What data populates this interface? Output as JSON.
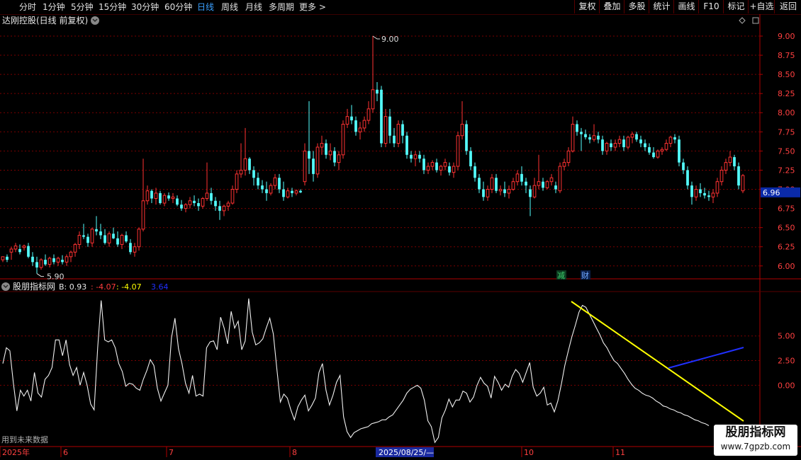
{
  "toolbar": {
    "periods": [
      {
        "label": "分时",
        "active": false
      },
      {
        "label": "1分钟",
        "active": false
      },
      {
        "label": "5分钟",
        "active": false
      },
      {
        "label": "15分钟",
        "active": false
      },
      {
        "label": "30分钟",
        "active": false
      },
      {
        "label": "60分钟",
        "active": false
      },
      {
        "label": "日线",
        "active": true
      },
      {
        "label": "周线",
        "active": false
      },
      {
        "label": "月线",
        "active": false
      },
      {
        "label": "多周期",
        "active": false
      },
      {
        "label": "更多 >",
        "active": false
      }
    ],
    "right_buttons": [
      "复权",
      "叠加",
      "多股",
      "统计",
      "画线",
      "F10",
      "标记",
      "+自选",
      "返回"
    ]
  },
  "main_chart": {
    "title": "达刚控股(日线 前复权)",
    "high_label": "9.00",
    "low_label": "5.90",
    "current_price": "6.96",
    "y_ticks": [
      "9.00",
      "8.75",
      "8.50",
      "8.25",
      "8.00",
      "7.75",
      "7.50",
      "7.25",
      "7.00",
      "6.75",
      "6.50",
      "6.25",
      "6.00"
    ],
    "event_markers": [
      {
        "label": "减"
      },
      {
        "label": "财"
      }
    ],
    "colors": {
      "up": "#ff3232",
      "down": "#54ffff",
      "grid": "#7a0000"
    }
  },
  "indicator": {
    "name": "股朋指标网",
    "b_label": "B: 0.93",
    "v2": "-4.07",
    "v3": ": -4.07",
    "v4": "3.64",
    "y_ticks": [
      "5.00",
      "2.50",
      "0.00"
    ],
    "footer_note": "用到未来数据"
  },
  "time_axis": {
    "labels": [
      "2025年",
      "6",
      "7",
      "8",
      "2025/08/25/—",
      "10",
      "11"
    ]
  },
  "watermark": {
    "line1": "股朋指标网",
    "line2": "www.7gpzb.com"
  },
  "chart_data": {
    "type": "candlestick",
    "price_range": [
      5.85,
      9.12
    ],
    "candles": [
      [
        6.08,
        6.12,
        6.05,
        6.12
      ],
      [
        6.12,
        6.15,
        6.05,
        6.08
      ],
      [
        6.18,
        6.25,
        6.08,
        6.22
      ],
      [
        6.22,
        6.3,
        6.18,
        6.26
      ],
      [
        6.22,
        6.28,
        6.15,
        6.18
      ],
      [
        6.24,
        6.28,
        6.2,
        6.26
      ],
      [
        6.26,
        6.3,
        6.1,
        6.12
      ],
      [
        6.12,
        6.18,
        6.0,
        6.05
      ],
      [
        6.05,
        6.12,
        5.9,
        5.98
      ],
      [
        5.98,
        6.1,
        5.95,
        6.08
      ],
      [
        6.08,
        6.15,
        6.0,
        6.02
      ],
      [
        6.02,
        6.12,
        5.98,
        6.1
      ],
      [
        6.1,
        6.15,
        6.02,
        6.05
      ],
      [
        6.05,
        6.12,
        6.0,
        6.1
      ],
      [
        6.08,
        6.14,
        6.02,
        6.05
      ],
      [
        6.05,
        6.15,
        6.0,
        6.12
      ],
      [
        6.12,
        6.2,
        6.05,
        6.18
      ],
      [
        6.18,
        6.3,
        6.12,
        6.28
      ],
      [
        6.28,
        6.45,
        6.22,
        6.4
      ],
      [
        6.4,
        6.55,
        6.35,
        6.38
      ],
      [
        6.38,
        6.42,
        6.25,
        6.3
      ],
      [
        6.3,
        6.5,
        6.25,
        6.48
      ],
      [
        6.48,
        6.65,
        6.4,
        6.45
      ],
      [
        6.45,
        6.55,
        6.35,
        6.4
      ],
      [
        6.4,
        6.48,
        6.28,
        6.3
      ],
      [
        6.3,
        6.45,
        6.25,
        6.42
      ],
      [
        6.42,
        6.5,
        6.35,
        6.36
      ],
      [
        6.36,
        6.45,
        6.25,
        6.28
      ],
      [
        6.28,
        6.42,
        6.22,
        6.4
      ],
      [
        6.4,
        6.45,
        6.3,
        6.32
      ],
      [
        6.3,
        6.35,
        6.15,
        6.18
      ],
      [
        6.18,
        6.3,
        6.12,
        6.25
      ],
      [
        6.25,
        6.5,
        6.2,
        6.48
      ],
      [
        6.48,
        7.4,
        6.45,
        6.85
      ],
      [
        6.85,
        7.05,
        6.8,
        6.98
      ],
      [
        6.98,
        7.0,
        6.82,
        6.88
      ],
      [
        6.88,
        7.02,
        6.8,
        6.95
      ],
      [
        6.95,
        6.98,
        6.8,
        6.82
      ],
      [
        6.82,
        6.95,
        6.78,
        6.92
      ],
      [
        6.92,
        6.96,
        6.85,
        6.88
      ],
      [
        6.88,
        6.95,
        6.82,
        6.9
      ],
      [
        6.88,
        6.92,
        6.78,
        6.8
      ],
      [
        6.8,
        6.86,
        6.72,
        6.75
      ],
      [
        6.75,
        6.82,
        6.7,
        6.8
      ],
      [
        6.8,
        6.9,
        6.75,
        6.85
      ],
      [
        6.85,
        6.92,
        6.78,
        6.82
      ],
      [
        6.82,
        6.88,
        6.72,
        6.78
      ],
      [
        6.78,
        6.9,
        6.75,
        6.88
      ],
      [
        6.88,
        7.35,
        6.85,
        6.95
      ],
      [
        6.95,
        7.02,
        6.8,
        6.85
      ],
      [
        6.85,
        6.9,
        6.72,
        6.78
      ],
      [
        6.78,
        6.85,
        6.6,
        6.72
      ],
      [
        6.72,
        6.8,
        6.65,
        6.78
      ],
      [
        6.78,
        6.85,
        6.72,
        6.82
      ],
      [
        6.82,
        7.05,
        6.8,
        7.0
      ],
      [
        7.0,
        7.25,
        6.95,
        7.2
      ],
      [
        7.2,
        7.6,
        7.15,
        7.25
      ],
      [
        7.25,
        7.8,
        7.18,
        7.4
      ],
      [
        7.4,
        7.42,
        7.2,
        7.25
      ],
      [
        7.25,
        7.3,
        7.05,
        7.15
      ],
      [
        7.15,
        7.22,
        7.0,
        7.05
      ],
      [
        7.05,
        7.12,
        6.95,
        7.0
      ],
      [
        7.0,
        7.1,
        6.85,
        6.95
      ],
      [
        6.95,
        7.08,
        6.92,
        7.05
      ],
      [
        7.05,
        7.2,
        7.0,
        7.15
      ],
      [
        7.15,
        7.2,
        6.95,
        7.0
      ],
      [
        7.0,
        7.1,
        6.85,
        6.9
      ],
      [
        6.9,
        7.02,
        6.88,
        6.98
      ],
      [
        6.98,
        7.02,
        6.9,
        6.95
      ],
      [
        6.95,
        7.0,
        6.92,
        6.98
      ],
      [
        6.98,
        7.0,
        6.95,
        6.96
      ],
      [
        7.1,
        7.6,
        7.05,
        7.5
      ],
      [
        7.5,
        8.15,
        7.2,
        7.4
      ],
      [
        7.4,
        7.5,
        7.1,
        7.2
      ],
      [
        7.2,
        7.6,
        7.15,
        7.55
      ],
      [
        7.55,
        7.7,
        7.45,
        7.6
      ],
      [
        7.6,
        7.65,
        7.4,
        7.45
      ],
      [
        7.45,
        7.6,
        7.38,
        7.5
      ],
      [
        7.5,
        7.55,
        7.3,
        7.35
      ],
      [
        7.35,
        7.5,
        7.25,
        7.45
      ],
      [
        7.45,
        7.9,
        7.4,
        7.85
      ],
      [
        7.85,
        8.05,
        7.8,
        7.95
      ],
      [
        7.95,
        8.1,
        7.85,
        7.9
      ],
      [
        7.9,
        7.95,
        7.7,
        7.75
      ],
      [
        7.75,
        7.88,
        7.65,
        7.8
      ],
      [
        7.8,
        7.95,
        7.75,
        7.9
      ],
      [
        7.9,
        8.15,
        7.85,
        8.05
      ],
      [
        8.05,
        9.0,
        8.0,
        8.3
      ],
      [
        8.3,
        8.4,
        8.15,
        8.25
      ],
      [
        8.3,
        8.35,
        7.55,
        7.6
      ],
      [
        7.6,
        8.05,
        7.55,
        7.95
      ],
      [
        7.95,
        8.05,
        7.6,
        7.7
      ],
      [
        7.7,
        7.8,
        7.55,
        7.6
      ],
      [
        7.6,
        7.9,
        7.55,
        7.85
      ],
      [
        7.85,
        7.9,
        7.6,
        7.7
      ],
      [
        7.7,
        7.75,
        7.4,
        7.45
      ],
      [
        7.45,
        7.5,
        7.35,
        7.4
      ],
      [
        7.4,
        7.5,
        7.3,
        7.45
      ],
      [
        7.45,
        7.5,
        7.35,
        7.4
      ],
      [
        7.4,
        7.45,
        7.2,
        7.25
      ],
      [
        7.25,
        7.35,
        7.2,
        7.3
      ],
      [
        7.3,
        7.38,
        7.25,
        7.35
      ],
      [
        7.35,
        7.4,
        7.22,
        7.25
      ],
      [
        7.25,
        7.32,
        7.18,
        7.3
      ],
      [
        7.3,
        7.4,
        7.25,
        7.35
      ],
      [
        7.3,
        7.35,
        7.18,
        7.22
      ],
      [
        7.22,
        7.35,
        7.15,
        7.3
      ],
      [
        7.3,
        7.75,
        7.25,
        7.7
      ],
      [
        7.7,
        8.15,
        7.65,
        7.85
      ],
      [
        7.85,
        7.9,
        7.45,
        7.5
      ],
      [
        7.5,
        7.55,
        7.25,
        7.3
      ],
      [
        7.3,
        7.35,
        7.1,
        7.15
      ],
      [
        7.15,
        7.2,
        6.95,
        7.0
      ],
      [
        7.0,
        7.1,
        6.85,
        6.9
      ],
      [
        6.9,
        7.05,
        6.85,
        7.0
      ],
      [
        7.0,
        7.2,
        6.95,
        7.15
      ],
      [
        7.15,
        7.2,
        6.95,
        6.98
      ],
      [
        6.98,
        7.05,
        6.92,
        7.0
      ],
      [
        7.0,
        7.1,
        6.9,
        6.95
      ],
      [
        6.95,
        7.05,
        6.88,
        7.0
      ],
      [
        7.0,
        7.15,
        6.98,
        7.1
      ],
      [
        7.1,
        7.25,
        7.05,
        7.2
      ],
      [
        7.2,
        7.3,
        7.05,
        7.1
      ],
      [
        7.1,
        7.15,
        6.95,
        7.05
      ],
      [
        7.0,
        7.05,
        6.65,
        6.9
      ],
      [
        6.9,
        7.15,
        6.88,
        7.05
      ],
      [
        7.05,
        7.45,
        7.0,
        7.1
      ],
      [
        7.1,
        7.15,
        6.98,
        7.02
      ],
      [
        7.02,
        7.12,
        7.0,
        7.1
      ],
      [
        7.1,
        7.2,
        7.05,
        7.15
      ],
      [
        7.05,
        7.1,
        6.95,
        7.0
      ],
      [
        6.98,
        7.35,
        6.95,
        7.3
      ],
      [
        7.3,
        7.4,
        7.25,
        7.35
      ],
      [
        7.35,
        7.55,
        7.3,
        7.5
      ],
      [
        7.5,
        7.95,
        7.48,
        7.85
      ],
      [
        7.85,
        7.9,
        7.7,
        7.75
      ],
      [
        7.75,
        7.8,
        7.5,
        7.72
      ],
      [
        7.72,
        7.78,
        7.65,
        7.68
      ],
      [
        7.68,
        7.72,
        7.6,
        7.65
      ],
      [
        7.65,
        7.85,
        7.62,
        7.7
      ],
      [
        7.7,
        7.75,
        7.6,
        7.65
      ],
      [
        7.65,
        7.7,
        7.45,
        7.5
      ],
      [
        7.5,
        7.62,
        7.45,
        7.6
      ],
      [
        7.6,
        7.65,
        7.5,
        7.55
      ],
      [
        7.55,
        7.65,
        7.5,
        7.6
      ],
      [
        7.6,
        7.7,
        7.55,
        7.65
      ],
      [
        7.65,
        7.7,
        7.5,
        7.55
      ],
      [
        7.55,
        7.7,
        7.52,
        7.68
      ],
      [
        7.68,
        7.75,
        7.6,
        7.72
      ],
      [
        7.72,
        7.75,
        7.62,
        7.65
      ],
      [
        7.65,
        7.7,
        7.55,
        7.6
      ],
      [
        7.6,
        7.65,
        7.5,
        7.55
      ],
      [
        7.55,
        7.6,
        7.45,
        7.48
      ],
      [
        7.48,
        7.55,
        7.4,
        7.42
      ],
      [
        7.42,
        7.52,
        7.4,
        7.5
      ],
      [
        7.5,
        7.55,
        7.45,
        7.52
      ],
      [
        7.52,
        7.65,
        7.5,
        7.6
      ],
      [
        7.6,
        7.7,
        7.55,
        7.68
      ],
      [
        7.68,
        7.72,
        7.6,
        7.65
      ],
      [
        7.65,
        7.7,
        7.3,
        7.35
      ],
      [
        7.35,
        7.4,
        7.2,
        7.25
      ],
      [
        7.25,
        7.3,
        7.0,
        7.05
      ],
      [
        7.05,
        7.1,
        6.8,
        6.9
      ],
      [
        6.9,
        7.05,
        6.85,
        7.0
      ],
      [
        7.0,
        7.08,
        6.9,
        6.95
      ],
      [
        6.95,
        7.02,
        6.88,
        6.92
      ],
      [
        6.92,
        6.98,
        6.85,
        6.9
      ],
      [
        6.9,
        7.0,
        6.82,
        6.95
      ],
      [
        6.95,
        7.15,
        6.9,
        7.1
      ],
      [
        7.1,
        7.3,
        7.05,
        7.25
      ],
      [
        7.25,
        7.4,
        7.2,
        7.35
      ],
      [
        7.35,
        7.5,
        7.3,
        7.42
      ],
      [
        7.42,
        7.45,
        7.25,
        7.3
      ],
      [
        7.3,
        7.35,
        7.0,
        7.05
      ],
      [
        6.98,
        7.2,
        6.95,
        7.18
      ]
    ],
    "indicator_series": {
      "white": [
        2.2,
        3.8,
        3.5,
        0.2,
        -2.6,
        -0.5,
        -1.1,
        -0.5,
        -1.6,
        1.3,
        -0.8,
        -1.2,
        0.6,
        1.0,
        1.8,
        4.6,
        4.6,
        3.0,
        4.6,
        2.1,
        1.0,
        1.8,
        0.0,
        1.3,
        0.0,
        -1.9,
        -2.5,
        3.8,
        8.6,
        4.6,
        4.4,
        4.6,
        3.8,
        2.2,
        1.4,
        -0.1,
        0.2,
        0.1,
        -0.3,
        -0.5,
        0.6,
        1.5,
        2.6,
        2.0,
        -0.3,
        -1.6,
        -0.8,
        0.0,
        4.8,
        6.8,
        3.7,
        2.2,
        0.2,
        -0.8,
        1.0,
        -1.1,
        -0.9,
        -1.1,
        3.8,
        4.4,
        4.5,
        3.6,
        6.9,
        5.8,
        4.2,
        7.5,
        5.8,
        6.5,
        3.6,
        4.5,
        8.8,
        5.4,
        4.1,
        4.3,
        4.7,
        5.8,
        6.8,
        5.2,
        1.7,
        -1.7,
        -0.9,
        -1.3,
        -2.5,
        -3.5,
        -2.2,
        -1.5,
        -1.0,
        -2.6,
        -2.0,
        -1.3,
        1.3,
        2.2,
        -0.5,
        -2.0,
        -1.0,
        0.3,
        1.0,
        -3.2,
        -4.7,
        -5.3,
        -4.8,
        -4.6,
        -4.4,
        -4.3,
        -4.2,
        -3.9,
        -3.8,
        -3.7,
        -3.5,
        -3.5,
        -3.2,
        -3.0,
        -2.5,
        -2.0,
        -1.5,
        -0.8,
        -0.4,
        -0.2,
        0.0,
        -0.3,
        -1.5,
        -3.6,
        -4.2,
        -5.8,
        -5.3,
        -3.3,
        -2.5,
        -1.4,
        -2.2,
        -1.5,
        -1.5,
        -0.6,
        -0.8,
        -1.7,
        -1.2,
        0.0,
        0.8,
        0.2,
        -0.1,
        -1.3,
        0.9,
        0.3,
        -0.5,
        0.1,
        -0.2,
        0.9,
        1.6,
        1.2,
        0.3,
        1.3,
        2.3,
        -0.2,
        -1.1,
        -0.8,
        -0.2,
        -2.0,
        -1.8,
        -2.7,
        -1.6,
        0.1,
        2.0,
        3.5,
        4.9,
        6.1,
        7.4,
        8.1,
        7.9,
        7.2,
        6.5,
        5.8,
        5.1,
        4.3,
        3.8,
        3.1,
        2.5,
        2.2,
        1.7,
        1.2,
        0.6,
        0.1,
        -0.3,
        -0.5,
        -0.8,
        -1.0,
        -1.1,
        -1.3,
        -1.6,
        -1.8,
        -2.1,
        -2.2,
        -2.4,
        -2.5,
        -2.7,
        -2.8,
        -3.0,
        -3.1,
        -3.3,
        -3.5,
        -3.6,
        -3.8,
        -3.9,
        -4.1
      ]
    }
  }
}
